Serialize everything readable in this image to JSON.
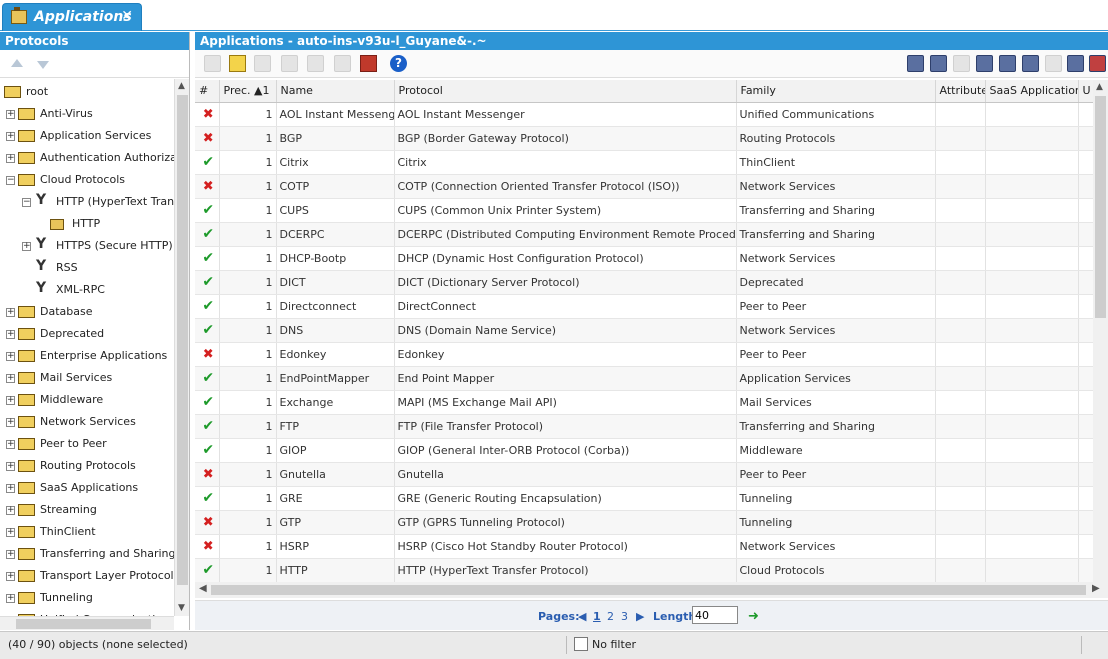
{
  "tab": {
    "title": "Applications",
    "close": "✕"
  },
  "left_panel": {
    "title": "Protocols",
    "tree": [
      {
        "label": "root",
        "depth": 0,
        "kind": "folder",
        "expander": ""
      },
      {
        "label": "Anti-Virus",
        "depth": 1,
        "kind": "folder",
        "expander": "+"
      },
      {
        "label": "Application Services",
        "depth": 1,
        "kind": "folder",
        "expander": "+"
      },
      {
        "label": "Authentication Authorization",
        "depth": 1,
        "kind": "folder",
        "expander": "+"
      },
      {
        "label": "Cloud Protocols",
        "depth": 1,
        "kind": "folder",
        "expander": "−"
      },
      {
        "label": "HTTP (HyperText Transfer Protocol)",
        "depth": 2,
        "kind": "proto",
        "expander": "−"
      },
      {
        "label": "HTTP",
        "depth": 3,
        "kind": "app",
        "expander": ""
      },
      {
        "label": "HTTPS (Secure HTTP)",
        "depth": 2,
        "kind": "proto",
        "expander": "+"
      },
      {
        "label": "RSS",
        "depth": 2,
        "kind": "proto",
        "expander": ""
      },
      {
        "label": "XML-RPC",
        "depth": 2,
        "kind": "proto",
        "expander": ""
      },
      {
        "label": "Database",
        "depth": 1,
        "kind": "folder",
        "expander": "+"
      },
      {
        "label": "Deprecated",
        "depth": 1,
        "kind": "folder",
        "expander": "+"
      },
      {
        "label": "Enterprise Applications",
        "depth": 1,
        "kind": "folder",
        "expander": "+"
      },
      {
        "label": "Mail Services",
        "depth": 1,
        "kind": "folder",
        "expander": "+"
      },
      {
        "label": "Middleware",
        "depth": 1,
        "kind": "folder",
        "expander": "+"
      },
      {
        "label": "Network Services",
        "depth": 1,
        "kind": "folder",
        "expander": "+"
      },
      {
        "label": "Peer to Peer",
        "depth": 1,
        "kind": "folder",
        "expander": "+"
      },
      {
        "label": "Routing Protocols",
        "depth": 1,
        "kind": "folder",
        "expander": "+"
      },
      {
        "label": "SaaS Applications",
        "depth": 1,
        "kind": "folder",
        "expander": "+"
      },
      {
        "label": "Streaming",
        "depth": 1,
        "kind": "folder",
        "expander": "+"
      },
      {
        "label": "ThinClient",
        "depth": 1,
        "kind": "folder",
        "expander": "+"
      },
      {
        "label": "Transferring and Sharing",
        "depth": 1,
        "kind": "folder",
        "expander": "+"
      },
      {
        "label": "Transport Layer Protocols",
        "depth": 1,
        "kind": "folder",
        "expander": "+"
      },
      {
        "label": "Tunneling",
        "depth": 1,
        "kind": "folder",
        "expander": "+"
      },
      {
        "label": "Unified Communications",
        "depth": 1,
        "kind": "folder",
        "expander": "+"
      }
    ]
  },
  "right_panel": {
    "title": "Applications - auto-ins-v93u-l_Guyane&-.~",
    "columns": [
      "#",
      "Prec. ▲1",
      "Name",
      "Protocol",
      "Family",
      "Attribute",
      "SaaS Application",
      "U"
    ],
    "rows": [
      {
        "status": "ko",
        "prec": "1",
        "name": "AOL Instant Messenger",
        "protocol": "AOL Instant Messenger",
        "family": "Unified Communications"
      },
      {
        "status": "ko",
        "prec": "1",
        "name": "BGP",
        "protocol": "BGP (Border Gateway Protocol)",
        "family": "Routing Protocols"
      },
      {
        "status": "ok",
        "prec": "1",
        "name": "Citrix",
        "protocol": "Citrix",
        "family": "ThinClient"
      },
      {
        "status": "ko",
        "prec": "1",
        "name": "COTP",
        "protocol": "COTP (Connection Oriented Transfer Protocol (ISO))",
        "family": "Network Services"
      },
      {
        "status": "ok",
        "prec": "1",
        "name": "CUPS",
        "protocol": "CUPS (Common Unix Printer System)",
        "family": "Transferring and Sharing"
      },
      {
        "status": "ok",
        "prec": "1",
        "name": "DCERPC",
        "protocol": "DCERPC (Distributed Computing Environment Remote Procedure Call)",
        "family": "Transferring and Sharing"
      },
      {
        "status": "ok",
        "prec": "1",
        "name": "DHCP-Bootp",
        "protocol": "DHCP (Dynamic Host Configuration Protocol)",
        "family": "Network Services"
      },
      {
        "status": "ok",
        "prec": "1",
        "name": "DICT",
        "protocol": "DICT (Dictionary Server Protocol)",
        "family": "Deprecated"
      },
      {
        "status": "ok",
        "prec": "1",
        "name": "Directconnect",
        "protocol": "DirectConnect",
        "family": "Peer to Peer"
      },
      {
        "status": "ok",
        "prec": "1",
        "name": "DNS",
        "protocol": "DNS (Domain Name Service)",
        "family": "Network Services"
      },
      {
        "status": "ko",
        "prec": "1",
        "name": "Edonkey",
        "protocol": "Edonkey",
        "family": "Peer to Peer"
      },
      {
        "status": "ok",
        "prec": "1",
        "name": "EndPointMapper",
        "protocol": "End Point Mapper",
        "family": "Application Services"
      },
      {
        "status": "ok",
        "prec": "1",
        "name": "Exchange",
        "protocol": "MAPI (MS Exchange Mail API)",
        "family": "Mail Services"
      },
      {
        "status": "ok",
        "prec": "1",
        "name": "FTP",
        "protocol": "FTP (File Transfer Protocol)",
        "family": "Transferring and Sharing"
      },
      {
        "status": "ok",
        "prec": "1",
        "name": "GIOP",
        "protocol": "GIOP (General Inter-ORB Protocol (Corba))",
        "family": "Middleware"
      },
      {
        "status": "ko",
        "prec": "1",
        "name": "Gnutella",
        "protocol": "Gnutella",
        "family": "Peer to Peer"
      },
      {
        "status": "ok",
        "prec": "1",
        "name": "GRE",
        "protocol": "GRE (Generic Routing Encapsulation)",
        "family": "Tunneling"
      },
      {
        "status": "ko",
        "prec": "1",
        "name": "GTP",
        "protocol": "GTP (GPRS Tunneling Protocol)",
        "family": "Tunneling"
      },
      {
        "status": "ko",
        "prec": "1",
        "name": "HSRP",
        "protocol": "HSRP (Cisco Hot Standby Router Protocol)",
        "family": "Network Services"
      },
      {
        "status": "ok",
        "prec": "1",
        "name": "HTTP",
        "protocol": "HTTP (HyperText Transfer Protocol)",
        "family": "Cloud Protocols"
      }
    ],
    "pager": {
      "pages_label": "Pages:",
      "pages": [
        "1",
        "2",
        "3"
      ],
      "current": "1",
      "length_label": "Length:",
      "length_value": "40"
    }
  },
  "status_bar": {
    "left": "(40 / 90) objects (none selected)",
    "filter": "No filter"
  },
  "icons": {
    "ok": "✔",
    "ko": "✖",
    "help": "?",
    "prev": "◀",
    "next": "▶",
    "refresh": "➜",
    "scroll_up": "▲",
    "scroll_down": "▼",
    "scroll_left": "◀",
    "scroll_right": "▶"
  },
  "colors": {
    "accent": "#2e95d6",
    "ok": "#1d9a2a",
    "ko": "#d42020"
  }
}
